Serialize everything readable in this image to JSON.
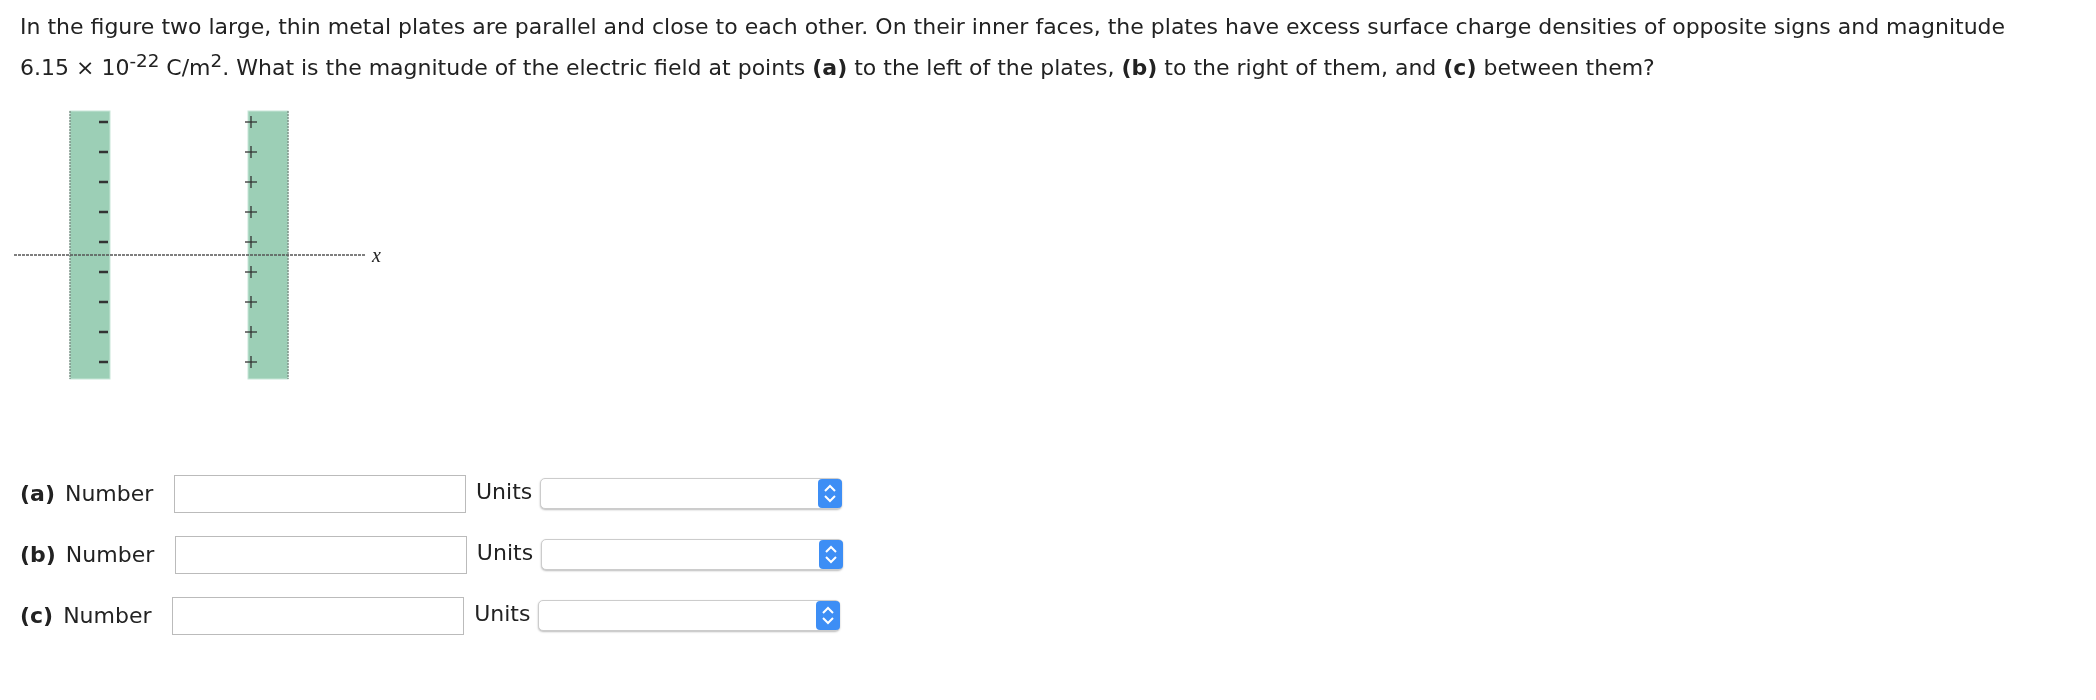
{
  "question": "In the figure two large, thin metal plates are parallel and close to each other. On their inner faces, the plates have excess surface charge densities of opposite signs and magnitude 6.15 × 10$^{-22}$ C/m$^{2}$. What is the magnitude of the electric field at points **(a)** to the left of the plates, **(b)** to the right of them, and **(c)** between them?",
  "figure": {
    "axis_label": "x",
    "plates": [
      {
        "kind": "negative"
      },
      {
        "kind": "positive"
      }
    ]
  },
  "answers": [
    {
      "part": "(a)",
      "label": "Number",
      "units_label": "Units"
    },
    {
      "part": "(b)",
      "label": "Number",
      "units_label": "Units"
    },
    {
      "part": "(c)",
      "label": "Number",
      "units_label": "Units"
    }
  ]
}
